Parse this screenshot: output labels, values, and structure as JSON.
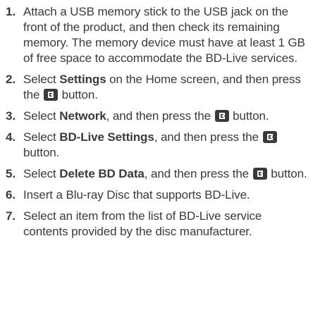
{
  "steps": [
    {
      "number": "1.",
      "text": "Attach a USB memory stick to the USB jack on the front of the product, and then check its remaining memory. The memory device must have at least 1 GB of free space to accommodate the BD-Live services."
    },
    {
      "number": "2.",
      "pre": "Select ",
      "bold": "Settings",
      "mid": " on the Home screen, and then press the ",
      "post": " button.",
      "icon": "enter-button-icon"
    },
    {
      "number": "3.",
      "pre": "Select ",
      "bold": "Network",
      "mid": ", and then press the ",
      "post": " button.",
      "icon": "enter-button-icon"
    },
    {
      "number": "4.",
      "pre": "Select ",
      "bold": "BD-Live Settings",
      "mid": ", and then press the ",
      "post": " button.",
      "icon": "enter-button-icon"
    },
    {
      "number": "5.",
      "pre": "Select ",
      "bold": "Delete BD Data",
      "mid": ", and then press the ",
      "post": " button.",
      "icon": "enter-button-icon"
    },
    {
      "number": "6.",
      "text": "Insert a Blu-ray Disc that supports BD-Live."
    },
    {
      "number": "7.",
      "text": "Select an item from the list of BD-Live service contents provided by the disc manufacturer."
    }
  ],
  "colors": {
    "text": "#3a3a3a",
    "icon": "#3a3a3a"
  }
}
